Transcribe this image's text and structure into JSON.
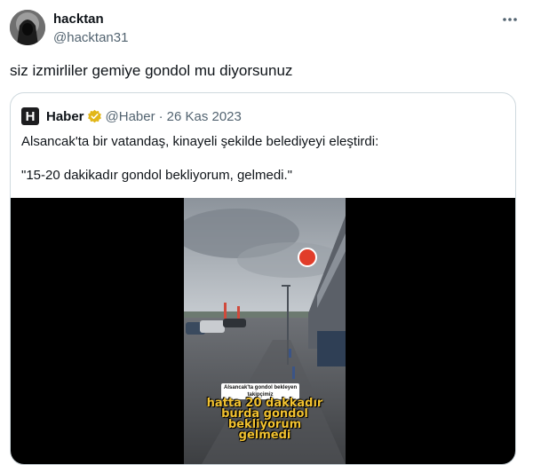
{
  "author": {
    "display_name": "hacktan",
    "handle": "@hacktan31",
    "avatar_icon": "hooded-figure-avatar"
  },
  "tweet": {
    "text": "siz izmirliler gemiye gondol mu diyorsunuz",
    "more_icon": "more-horizontal-icon"
  },
  "quote": {
    "logo_letter": "H",
    "name": "Haber",
    "verified_icon": "verified-gold-badge-icon",
    "handle": "@Haber",
    "separator": "·",
    "date": "26 Kas 2023",
    "text_line1": "Alsancak'ta bir vatandaş, kinayeli şekilde belediyeyi eleştirdi:",
    "text_line2": "\"15-20 dakikadır gondol bekliyorum, gelmedi.\"",
    "video": {
      "caption_small_1": "Alsancak'ta gondol bekleyen",
      "caption_small_2": "takipçimiz",
      "caption_big_1": "hatta 20 dakkadır",
      "caption_big_2": "burda gondol",
      "caption_big_3": "bekliyorum",
      "caption_big_4": "gelmedi"
    }
  },
  "colors": {
    "text_primary": "#0f1419",
    "text_secondary": "#536471",
    "border": "#cfd9de",
    "caption_yellow": "#f2c230"
  }
}
